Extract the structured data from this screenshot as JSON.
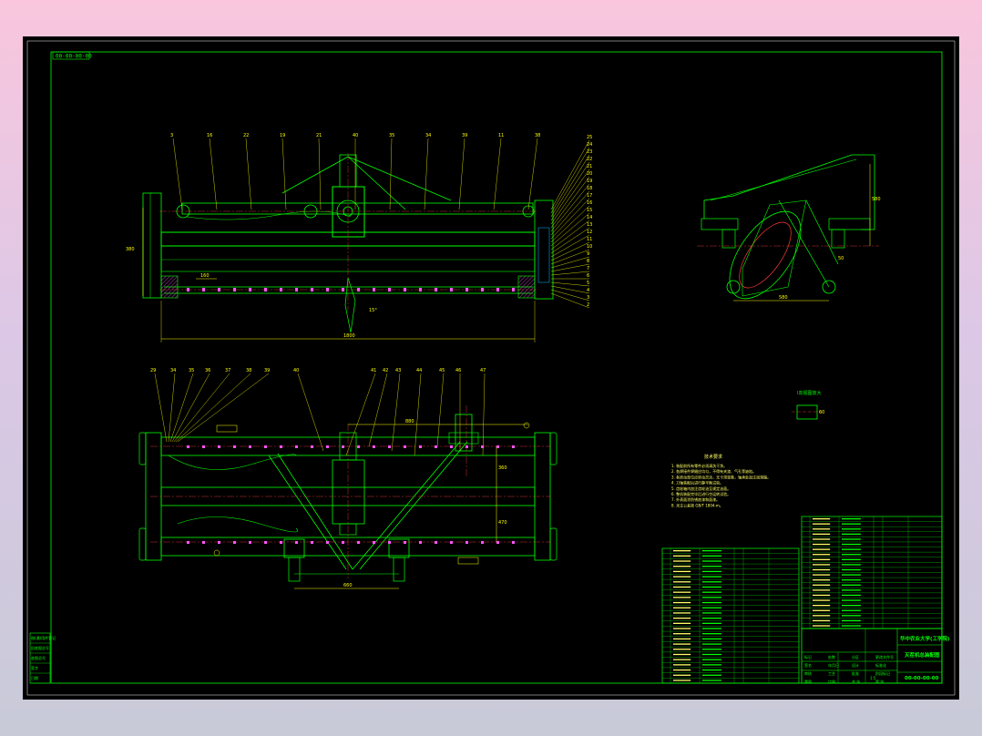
{
  "sheet": {
    "code_box": "00-00-00-00",
    "background": "#000000",
    "line_color": "#00ff00",
    "dim_color": "#ffff00",
    "center_color": "#ff3b3b",
    "mark_color": "#ff55ff"
  },
  "front_view": {
    "balloons": [
      "3",
      "16",
      "22",
      "19",
      "21",
      "40",
      "35",
      "34",
      "39",
      "11",
      "38",
      "25",
      "24",
      "23",
      "22",
      "21",
      "20",
      "19",
      "18",
      "17",
      "16",
      "15",
      "14",
      "13",
      "12",
      "11",
      "10",
      "9",
      "8",
      "7",
      "6",
      "5",
      "4",
      "3",
      "2"
    ],
    "dims": {
      "overall_width": "1800",
      "height": "380",
      "pitch": "160",
      "tilt": "15°"
    }
  },
  "top_view": {
    "balloons": [
      "29",
      "34",
      "35",
      "36",
      "37",
      "38",
      "39",
      "40",
      "41",
      "42",
      "43",
      "44",
      "45",
      "46",
      "47"
    ],
    "dims": {
      "span_top": "880",
      "span_bottom": "660",
      "height_right": "360",
      "height_left": "470"
    }
  },
  "side_view": {
    "dims": {
      "base": "580",
      "height": "580",
      "offset": "50"
    }
  },
  "detail": {
    "title": "I向视图放大",
    "dim": "60"
  },
  "notes": {
    "title": "技术要求",
    "lines": [
      "1. 装配前所有零件必须清洗干净。",
      "2. 各焊接件焊缝应均匀，不得有夹渣、气孔等缺陷。",
      "3. 各转动部位应转动灵活，无卡滞现象，轴承处加注润滑脂。",
      "4. 刀轴装配后进行静平衡试验。",
      "5. 齿轮箱内加注齿轮油至规定油面。",
      "6. 整机装配完毕后进行空运转试验。",
      "7. 外表面涂防锈底漆和面漆。",
      "8. 未注公差按 GB/T 1804-m。"
    ]
  },
  "title_block": {
    "school": "华中农业大学(工学院)",
    "drawing_name": "灭茬机总装配图",
    "drawing_no": "00-00-00-00",
    "labels": [
      "标记",
      "处数",
      "分区",
      "更改文件号",
      "签名",
      "年月日",
      "设计",
      "标准化",
      "审核",
      "工艺",
      "批准",
      "阶段标记",
      "重量",
      "比例",
      "共 张",
      "第 张"
    ],
    "scale": "1:5"
  },
  "stamp": {
    "rows": [
      "借(通)用件登记",
      "旧底图总号",
      "底图总号",
      "签字",
      "日期"
    ]
  }
}
